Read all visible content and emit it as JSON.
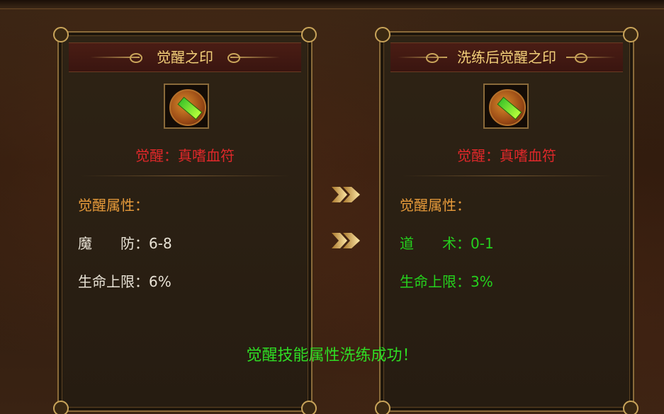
{
  "left_panel": {
    "title": "觉醒之印",
    "item_name": "觉醒：真嗜血符",
    "attr_heading": "觉醒属性：",
    "attrs": [
      "魔　　防：6-8",
      "生命上限：6%"
    ]
  },
  "right_panel": {
    "title": "洗练后觉醒之印",
    "item_name": "觉醒：真嗜血符",
    "attr_heading": "觉醒属性：",
    "attrs": [
      "道　　术：0-1",
      "生命上限：3%"
    ]
  },
  "result_message": "觉醒技能属性洗练成功！",
  "icons": {
    "item": "blood-talisman-icon",
    "arrow": "double-arrow-right-icon"
  },
  "colors": {
    "title_gold": "#f2cf79",
    "item_name_red": "#e0282a",
    "heading_orange": "#e69a3a",
    "stat_white": "#e9e3d6",
    "stat_green": "#25d11d"
  }
}
